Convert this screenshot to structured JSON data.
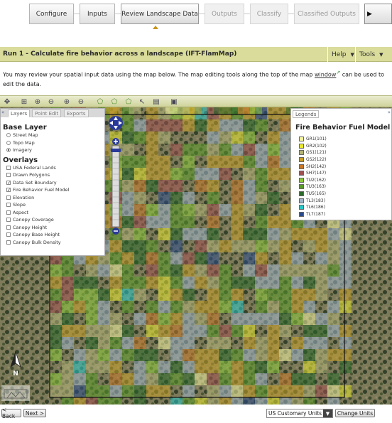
{
  "wizard": {
    "steps": [
      {
        "label": "Configure",
        "state": "enabled"
      },
      {
        "label": "Inputs",
        "state": "enabled"
      },
      {
        "label": "Review Landscape Data",
        "state": "current"
      },
      {
        "label": "Outputs",
        "state": "disabled"
      },
      {
        "label": "Classify",
        "state": "disabled"
      },
      {
        "label": "Classified Outputs",
        "state": "disabled"
      }
    ],
    "next_arrow": "▶"
  },
  "run": {
    "title": "Run 1 - Calculate fire behavior across a landscape (IFT-FlamMap)",
    "help_label": "Help",
    "tools_label": "Tools"
  },
  "intro": {
    "text_before": "You may review your spatial input data using the map below. The map editing tools along the top of the map ",
    "link": "window",
    "text_after": " can be used to edit the data."
  },
  "map_toolbar": {
    "icons": [
      "pan-icon",
      "zoom-extent-icon",
      "zoom-in-icon",
      "zoom-out-icon",
      "zoom-in-box-icon",
      "zoom-out-box-icon",
      "add-polygon-icon",
      "edit-polygon-icon",
      "select-polygon-icon",
      "pointer-icon",
      "attribute-table-icon",
      "identify-icon"
    ]
  },
  "layers_panel": {
    "tabs": [
      "Layers",
      "Point Edit",
      "Exports"
    ],
    "active_tab": "Layers",
    "base_layer_title": "Base Layer",
    "base_layers": [
      {
        "label": "Street Map",
        "selected": false
      },
      {
        "label": "Topo Map",
        "selected": false
      },
      {
        "label": "Imagery",
        "selected": true
      }
    ],
    "overlays_title": "Overlays",
    "overlays": [
      {
        "label": "USA Federal Lands",
        "checked": false
      },
      {
        "label": "Drawn Polygons",
        "checked": false
      },
      {
        "label": "Data Set Boundary",
        "checked": true
      },
      {
        "label": "Fire Behavior Fuel Model",
        "checked": true
      },
      {
        "label": "Elevation",
        "checked": false
      },
      {
        "label": "Slope",
        "checked": false
      },
      {
        "label": "Aspect",
        "checked": false
      },
      {
        "label": "Canopy Coverage",
        "checked": false
      },
      {
        "label": "Canopy Height",
        "checked": false
      },
      {
        "label": "Canopy Base Height",
        "checked": false
      },
      {
        "label": "Canopy Bulk Density",
        "checked": false
      }
    ]
  },
  "legend_panel": {
    "tab": "Legends",
    "title": "Fire Behavior Fuel Model",
    "items": [
      {
        "label": "GR1(101)",
        "color": "#f3f3a0"
      },
      {
        "label": "GR2(102)",
        "color": "#e8e830"
      },
      {
        "label": "GS1(121)",
        "color": "#b4b478"
      },
      {
        "label": "GS2(122)",
        "color": "#c8a028"
      },
      {
        "label": "SH2(142)",
        "color": "#c87828"
      },
      {
        "label": "SH7(147)",
        "color": "#a05050"
      },
      {
        "label": "TU2(162)",
        "color": "#8cc83c"
      },
      {
        "label": "TU3(163)",
        "color": "#5a9a2a"
      },
      {
        "label": "TU5(165)",
        "color": "#2a6a2a"
      },
      {
        "label": "TL3(183)",
        "color": "#a0b4c8"
      },
      {
        "label": "TL6(186)",
        "color": "#28c8c8"
      },
      {
        "label": "TL7(187)",
        "color": "#2a4a8a"
      }
    ]
  },
  "map": {
    "north_label": "N"
  },
  "bottom": {
    "back_label": "< Back",
    "next_label": "Next >",
    "units_value": "US Customary Units",
    "change_units_label": "Change Units"
  }
}
